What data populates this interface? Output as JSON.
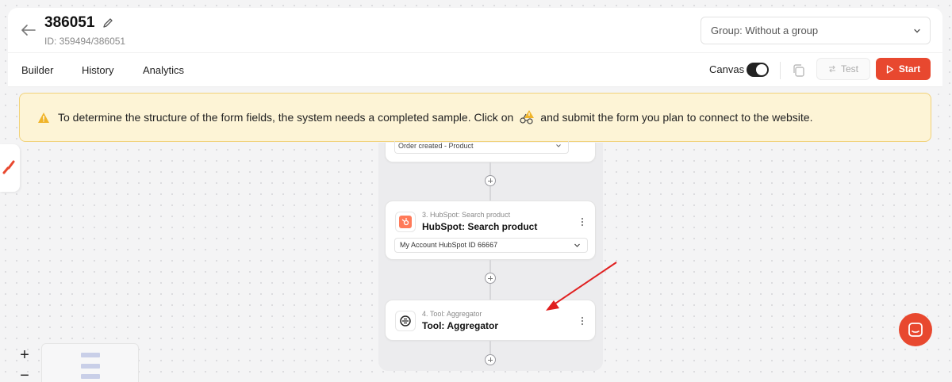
{
  "header": {
    "title": "386051",
    "subtitle": "ID: 359494/386051",
    "group_select": "Group: Without a group"
  },
  "tabs": [
    {
      "label": "Builder"
    },
    {
      "label": "History"
    },
    {
      "label": "Analytics"
    }
  ],
  "toolbar": {
    "canvas_label": "Canvas",
    "canvas_enabled": true,
    "test_label": "Test",
    "start_label": "Start"
  },
  "alert": {
    "text_before": "To determine the structure of the form fields, the system needs a completed sample. Click on",
    "text_after": "and submit the form you plan to connect to the website."
  },
  "steps": [
    {
      "select_value": "Order created - Product"
    },
    {
      "subtitle": "3. HubSpot: Search product",
      "title": "HubSpot: Search product",
      "account": "My Account HubSpot ID 66667"
    },
    {
      "subtitle": "4. Tool: Aggregator",
      "title": "Tool: Aggregator"
    }
  ],
  "zoom": {
    "in": "+",
    "out": "−"
  },
  "colors": {
    "accent": "#e8482f",
    "alert_bg": "#fdf4d6",
    "alert_border": "#f1d27a",
    "arrow": "#e02020"
  }
}
